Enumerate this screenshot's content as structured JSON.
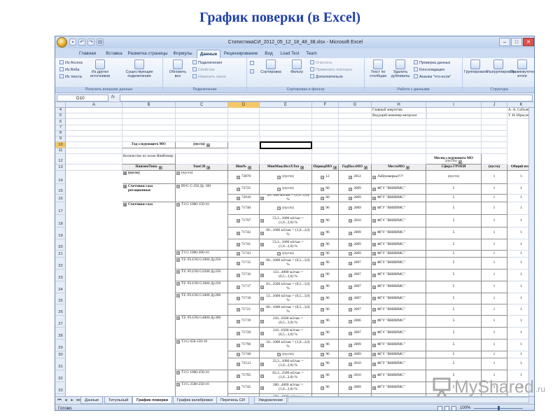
{
  "slide_title": "График поверки (в Excel)",
  "window": {
    "title": "СтатистикаСИ_2012_05_12_18_48_38.xlsx - Microsoft Excel",
    "controls": [
      "–",
      "□",
      "✕"
    ]
  },
  "ribbon_tabs": [
    "Главная",
    "Вставка",
    "Разметка страницы",
    "Формулы",
    "Данные",
    "Рецензирование",
    "Вид",
    "Load Test",
    "Team"
  ],
  "active_tab": "Данные",
  "ribbon": {
    "external": {
      "label": "Получить внешние данные",
      "items": [
        "Из Access",
        "Из Веба",
        "Из текста"
      ],
      "other_sources": "Из других источников",
      "existing": "Существующие подключения"
    },
    "connections": {
      "label": "Подключения",
      "refresh": "Обновить все",
      "items": [
        "Подключения",
        "Свойства",
        "Изменить связи"
      ]
    },
    "sort_filter": {
      "label": "Сортировка и фильтр",
      "sort": "Сортировка",
      "filter": "Фильтр",
      "items": [
        "Очистить",
        "Применить повторно",
        "Дополнительно"
      ]
    },
    "data_tools": {
      "label": "Работа с данными",
      "text_to_cols": "Текст по столбцам",
      "remove_dups": "Удалить дубликаты",
      "items": [
        "Проверка данных",
        "Консолидация",
        "Анализ \"что-если\""
      ]
    },
    "outline": {
      "label": "Структура",
      "group": "Группировать",
      "ungroup": "Разгруппировать",
      "subtotal": "Промежуточные итоги"
    }
  },
  "formula_bar": {
    "name_box": "D10",
    "fx": "fx",
    "value": ""
  },
  "columns": [
    "A",
    "B",
    "C",
    "D",
    "E",
    "F",
    "G",
    "H",
    "I",
    "J",
    "K"
  ],
  "selected_column": "D",
  "info_rows": {
    "r4": {
      "h": "Главный энергетик",
      "k": "А. А. Соболев"
    },
    "r5": {
      "h": "Ведущий инженер-метролог",
      "k": "Т. Н. Юрасов"
    }
  },
  "filter_row": {
    "label": "Год следующего МО",
    "value": "(пусто)"
  },
  "pivot_header": {
    "count_by": "Количество по полю ИнвНомер",
    "month_label": "Месяц следующего МО",
    "month_value": "(пусто)"
  },
  "field_headers": [
    "НаименТипа",
    "ТипСИ",
    "Инв№",
    "МинМаксВелXТоч",
    "ПериодМО",
    "ГодПослМО",
    "МестоМО",
    "Сфера ГРОЕИ",
    "(пусто)",
    "Общий итог"
  ],
  "rows": [
    {
      "n": "14",
      "a": "(пусто)",
      "b": "(пусто)",
      "c": "72870",
      "d": "(пусто)",
      "e": "12",
      "f": "2012",
      "g": "Лаб(поверка)???",
      "h": "(пусто)",
      "i": "1",
      "j": "1"
    },
    {
      "n": "15",
      "a": "Счетчики газа ротационные",
      "b": "RVG G 250 Ду 100",
      "c": "72725",
      "d": "(пусто)",
      "e": "60",
      "f": "2009",
      "g": "ФГУ \"ВНИИМС\"",
      "h": "5",
      "i": "1",
      "j": "1"
    },
    {
      "n": "16",
      "a": "",
      "b": "",
      "c": "72010",
      "d": "20...400 м3/час = (1,0...2,0) %",
      "e": "60",
      "f": "2009",
      "g": "ФГУ \"ВНИИМС\"",
      "h": "5",
      "i": "1",
      "j": "1"
    },
    {
      "n": "17",
      "a": "Счетчики газа",
      "b": "ТЗ G 1000-150-16",
      "c": "71740",
      "d": "(пусто)",
      "e": "96",
      "f": "2009",
      "g": "ФГУ \"ВНИИМС\"",
      "h": "5",
      "i": "1",
      "j": "1"
    },
    {
      "n": "18",
      "a": "",
      "b": "",
      "c": "71797",
      "d": "53,3...1600 м3/час = (1,0...2,0) %",
      "e": "96",
      "f": "2010",
      "g": "ФГУ \"ВНИИМС\"",
      "h": "5",
      "i": "1",
      "j": "1"
    },
    {
      "n": "19",
      "a": "",
      "b": "",
      "c": "71742",
      "d": "80...1600 м3/час = (1,0...2,0) %",
      "e": "96",
      "f": "2009",
      "g": "ФГУ \"ВНИИМС\"",
      "h": "5",
      "i": "1",
      "j": "1"
    },
    {
      "n": "20",
      "a": "",
      "b": "",
      "c": "71741",
      "d": "53,3...1600 м3/час = (1,0...2,0) %",
      "e": "96",
      "f": "2009",
      "g": "ФГУ \"ВНИИМС\"",
      "h": "5",
      "i": "1",
      "j": "1"
    },
    {
      "n": "21",
      "a": "",
      "b": "ТЗ G 1000-200-16",
      "c": "71743",
      "d": "(пусто)",
      "e": "96",
      "f": "2009",
      "g": "ФГУ \"ВНИИМС\"",
      "h": "5",
      "i": "1",
      "j": "1"
    },
    {
      "n": "22",
      "a": "",
      "b": "TZ /FLUXI G1000 Ду250",
      "c": "71715",
      "d": "80...1600 м3/час = (0,5...3,0) %",
      "e": "96",
      "f": "2007",
      "g": "ФГУ \"ВНИИМС\"",
      "h": "5",
      "i": "1",
      "j": "1"
    },
    {
      "n": "23",
      "a": "",
      "b": "TZ /FLUXI G2500 Ду250",
      "c": "71716",
      "d": "133...4000 м3/час = (0,5...3,0) %",
      "e": "96",
      "f": "2007",
      "g": "ФГУ \"ВНИИМС\"",
      "h": "5",
      "i": "1",
      "j": "1"
    },
    {
      "n": "24",
      "a": "",
      "b": "TZ /FLUXI G1600 Ду250",
      "c": "71717",
      "d": "83...2500 м3/час = (0,5...3,0) %",
      "e": "96",
      "f": "2007",
      "g": "ФГУ \"ВНИИМС\"",
      "h": "5",
      "i": "1",
      "j": "1"
    },
    {
      "n": "25",
      "a": "",
      "b": "TZ /FLUXI G1000 Ду200",
      "c": "71718",
      "d": "53...1600 м3/час = (0,5...3,0) %",
      "e": "96",
      "f": "2007",
      "g": "ФГУ \"ВНИИМС\"",
      "h": "5",
      "i": "1",
      "j": "1"
    },
    {
      "n": "26",
      "a": "",
      "b": "",
      "c": "71721",
      "d": "80...1600 м3/час = (0,5...3,0) %",
      "e": "96",
      "f": "2007",
      "g": "ФГУ \"ВНИИМС\"",
      "h": "5",
      "i": "1",
      "j": "1"
    },
    {
      "n": "27",
      "a": "",
      "b": "TZ /FLUXI G4000 Ду300",
      "c": "71719",
      "d": "216...6500 м3/час = (0,5...3,0) %",
      "e": "96",
      "f": "2006",
      "g": "ФГУ \"ВНИИМС\"",
      "h": "5",
      "i": "1",
      "j": "1"
    },
    {
      "n": "28",
      "a": "",
      "b": "",
      "c": "71720",
      "d": "216...6500 м3/час = (0,5...3,0) %",
      "e": "96",
      "f": "2007",
      "g": "ФГУ \"ВНИИМС\"",
      "h": "5",
      "i": "1",
      "j": "1"
    },
    {
      "n": "29",
      "a": "",
      "b": "ТЗ G 650-150-16",
      "c": "71796",
      "d": "50...1000 м3/час = (1,0...2,0) %",
      "e": "96",
      "f": "2009",
      "g": "ФГУ \"ВНИИМС\"",
      "h": "5",
      "i": "1",
      "j": "1"
    },
    {
      "n": "30",
      "a": "",
      "b": "",
      "c": "71748",
      "d": "(пусто)",
      "e": "96",
      "f": "2009",
      "g": "ФГУ \"ВНИИМС\"",
      "h": "5",
      "i": "1",
      "j": "1"
    },
    {
      "n": "31",
      "a": "",
      "b": "",
      "c": "72513",
      "d": "33,3...1000 м3/час = (1,0...2,0) %",
      "e": "96",
      "f": "2010",
      "g": "ФГУ \"ВНИИМС\"",
      "h": "5",
      "i": "1",
      "j": "1"
    },
    {
      "n": "32",
      "a": "",
      "b": "ТЗ G 1600-250-16",
      "c": "71795",
      "d": "83,3...2500 м3/час = (1,0...2,0) %",
      "e": "96",
      "f": "2010",
      "g": "ФГУ \"ВНИИМС\"",
      "h": "5",
      "i": "1",
      "j": "1"
    },
    {
      "n": "33",
      "a": "",
      "b": "ТЗ G 2500-250-16",
      "c": "71745",
      "d": "200...4000 м3/час = (1,0...2,0) %",
      "e": "96",
      "f": "2009",
      "g": "ФГУ \"ВНИИМС\"",
      "h": "5",
      "i": "1",
      "j": "1"
    },
    {
      "n": "34",
      "a": "",
      "b": "",
      "c": "71744",
      "d": "200...4000 м3/час = (1,0...2,0) %",
      "e": "96",
      "f": "2009",
      "g": "ФГУ \"ВНИИМС\"",
      "h": "5",
      "i": "1",
      "j": "1"
    }
  ],
  "sheet_tabs": [
    "Данные",
    "Титульный",
    "График поверки",
    "График калибровки",
    "Перечень СИ",
    "Уведомление"
  ],
  "active_sheet": "График поверки",
  "status": {
    "ready": "Готово",
    "zoom": "100%"
  },
  "watermark": {
    "brand": "MyShared",
    "suffix": ".ru"
  }
}
